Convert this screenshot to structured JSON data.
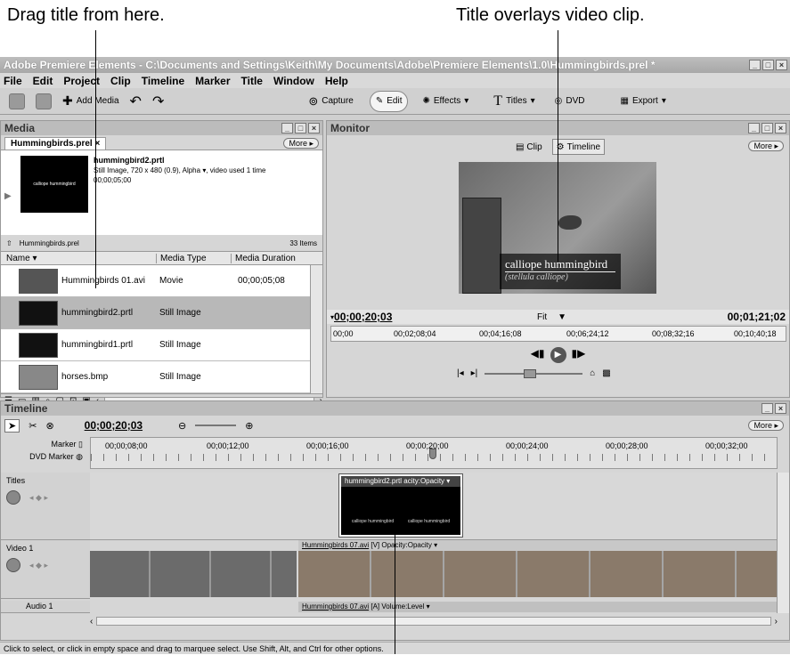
{
  "callouts": {
    "left": "Drag title from here.",
    "right": "Title overlays video clip."
  },
  "window": {
    "title": "Adobe Premiere Elements - C:\\Documents and Settings\\Keith\\My Documents\\Adobe\\Premiere Elements\\1.0\\Hummingbirds.prel *"
  },
  "menu": [
    "File",
    "Edit",
    "Project",
    "Clip",
    "Timeline",
    "Marker",
    "Title",
    "Window",
    "Help"
  ],
  "toolbar": {
    "add_media": "Add Media",
    "capture": "Capture",
    "edit": "Edit",
    "effects": "Effects",
    "titles": "Titles",
    "dvd": "DVD",
    "export": "Export"
  },
  "media": {
    "panel_title": "Media",
    "tab": "Hummingbirds.prel",
    "more": "More",
    "preview_name": "hummingbird2.prtl",
    "preview_info1": "Still Image, 720 x 480 (0.9), Alpha",
    "preview_info1b": ", video used 1 time",
    "preview_info2": "00;00;05;00",
    "thumb_text": "calliope hummingbird",
    "project_name": "Hummingbirds.prel",
    "item_count": "33 Items",
    "columns": {
      "name": "Name",
      "type": "Media Type",
      "duration": "Media Duration"
    },
    "rows": [
      {
        "name": "Hummingbirds 01.avi",
        "type": "Movie",
        "duration": "00;00;05;08"
      },
      {
        "name": "hummingbird2.prtl",
        "type": "Still Image",
        "duration": ""
      },
      {
        "name": "hummingbird1.prtl",
        "type": "Still Image",
        "duration": ""
      },
      {
        "name": "horses.bmp",
        "type": "Still Image",
        "duration": ""
      }
    ]
  },
  "monitor": {
    "panel_title": "Monitor",
    "more": "More",
    "clip_btn": "Clip",
    "timeline_btn": "Timeline",
    "overlay_title": "calliope hummingbird",
    "overlay_sub": "(stellula calliope)",
    "current_tc": "00;00;20;03",
    "zoom": "Fit",
    "duration_tc": "00;01;21;02",
    "ruler": [
      "00;00",
      "00;02;08;04",
      "00;04;16;08",
      "00;06;24;12",
      "00;08;32;16",
      "00;10;40;18"
    ]
  },
  "timeline": {
    "panel_title": "Timeline",
    "more": "More",
    "current_tc": "00;00;20;03",
    "marker_label": "Marker",
    "dvd_marker_label": "DVD Marker",
    "ruler": [
      "00;00;08;00",
      "00;00;12;00",
      "00;00;16;00",
      "00;00;20;00",
      "00;00;24;00",
      "00;00;28;00",
      "00;00;32;00"
    ],
    "tracks": {
      "titles": "Titles",
      "video1": "Video 1",
      "audio1": "Audio 1"
    },
    "title_clip": "hummingbird2.prtl",
    "title_clip_fx": "acity:Opacity",
    "title_clip_text": "calliope hummingbird",
    "video_clip": "Hummingbirds 07.avi",
    "video_clip_fx": "[V] Opacity:Opacity",
    "audio_clip": "Hummingbirds 07.avi",
    "audio_clip_fx": "[A] Volume:Level"
  },
  "status": "Click to select, or click in empty space and drag to marquee select. Use Shift, Alt, and Ctrl for other options."
}
